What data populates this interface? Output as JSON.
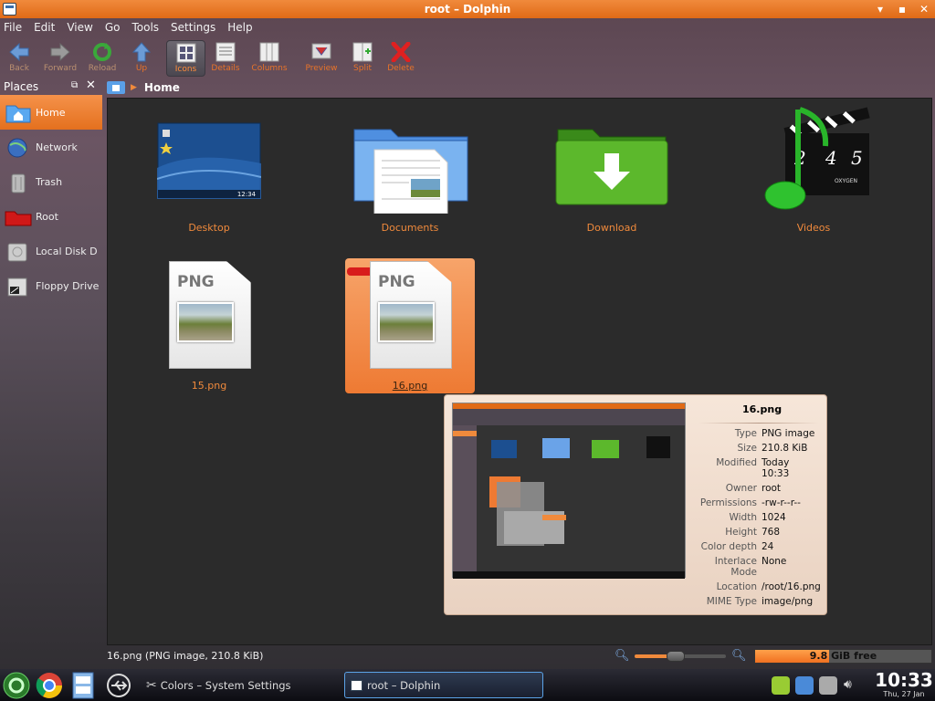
{
  "window": {
    "title": "root – Dolphin",
    "controls": [
      "▾",
      "▪",
      "✕"
    ]
  },
  "menu": [
    "File",
    "Edit",
    "View",
    "Go",
    "Tools",
    "Settings",
    "Help"
  ],
  "toolbar": {
    "back": "Back",
    "forward": "Forward",
    "reload": "Reload",
    "up": "Up",
    "icons": "Icons",
    "details": "Details",
    "columns": "Columns",
    "preview": "Preview",
    "split": "Split",
    "delete": "Delete"
  },
  "places": {
    "title": "Places",
    "items": [
      {
        "label": "Home"
      },
      {
        "label": "Network"
      },
      {
        "label": "Trash"
      },
      {
        "label": "Root"
      },
      {
        "label": "Local Disk D"
      },
      {
        "label": "Floppy Drive"
      }
    ]
  },
  "breadcrumb": {
    "current": "Home"
  },
  "files": [
    {
      "name": "Desktop",
      "clock": "12:34"
    },
    {
      "name": "Documents"
    },
    {
      "name": "Download"
    },
    {
      "name": "Videos",
      "clap": [
        "2",
        "4",
        "5"
      ],
      "clap_label": "OXYGEN"
    },
    {
      "name": "15.png",
      "badge": "PNG"
    },
    {
      "name": "16.png",
      "badge": "PNG"
    }
  ],
  "tooltip": {
    "title": "16.png",
    "rows": [
      {
        "k": "Type",
        "v": "PNG image"
      },
      {
        "k": "Size",
        "v": "210.8 KiB"
      },
      {
        "k": "Modified",
        "v": "Today\n10:33"
      },
      {
        "k": "Owner",
        "v": "root"
      },
      {
        "k": "Permissions",
        "v": "-rw-r--r--"
      },
      {
        "k": "Width",
        "v": "1024"
      },
      {
        "k": "Height",
        "v": "768"
      },
      {
        "k": "Color depth",
        "v": "24"
      },
      {
        "k": "Interlace Mode",
        "v": "None"
      },
      {
        "k": "Location",
        "v": "/root/16.png"
      },
      {
        "k": "MIME Type",
        "v": "image/png"
      }
    ]
  },
  "status": {
    "text": "16.png (PNG image, 210.8 KiB)",
    "zoom_fraction": 0.45,
    "free_text": "9.8 GiB free",
    "used_fraction": 0.42
  },
  "taskbar": {
    "tasks": [
      {
        "label": "Colors – System Settings"
      },
      {
        "label": "root – Dolphin"
      }
    ],
    "clock": "10:33",
    "date": "Thu, 27 Jan"
  },
  "colors": {
    "accent": "#f08a3c",
    "selection": "#ee7a33"
  }
}
